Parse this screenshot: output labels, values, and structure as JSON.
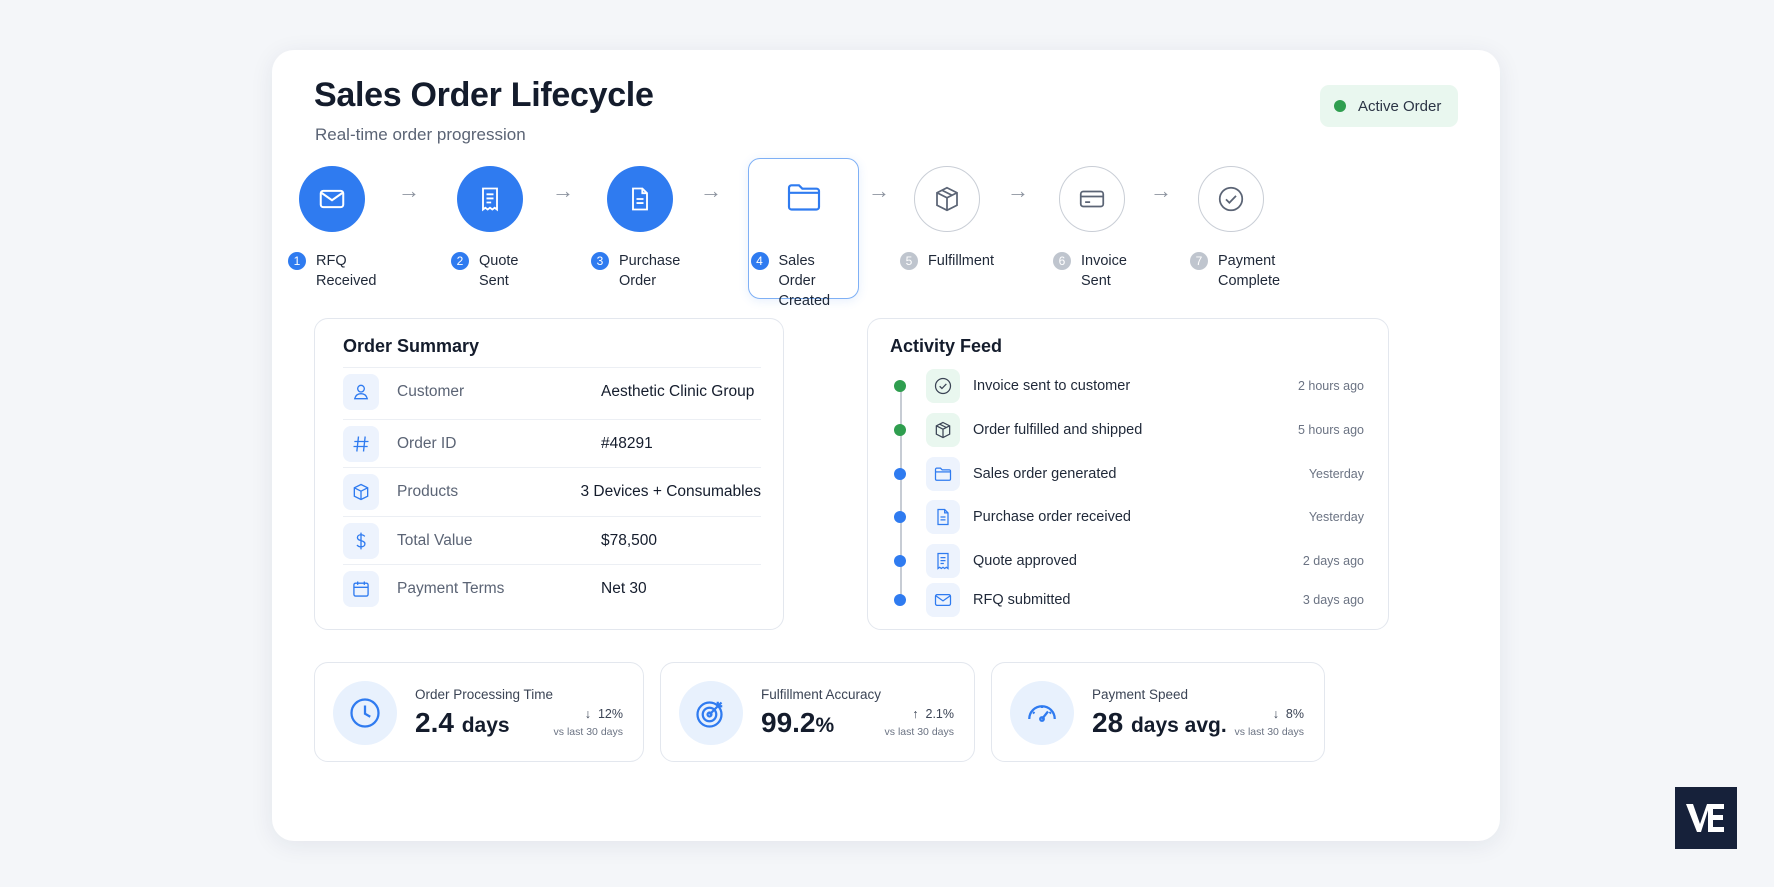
{
  "header": {
    "title": "Sales Order Lifecycle",
    "subtitle": "Real-time order progression",
    "status_label": "Active Order",
    "status_color": "#2f9e4f"
  },
  "steps": [
    {
      "num": "1",
      "label": "RFQ Received",
      "icon": "envelope-icon",
      "state": "done"
    },
    {
      "num": "2",
      "label": "Quote Sent",
      "icon": "receipt-icon",
      "state": "done"
    },
    {
      "num": "3",
      "label": "Purchase Order",
      "icon": "document-icon",
      "state": "done"
    },
    {
      "num": "4",
      "label": "Sales Order Created",
      "icon": "folder-icon",
      "state": "current"
    },
    {
      "num": "5",
      "label": "Fulfillment",
      "icon": "box-icon",
      "state": "pending"
    },
    {
      "num": "6",
      "label": "Invoice Sent",
      "icon": "credit-card-icon",
      "state": "pending"
    },
    {
      "num": "7",
      "label": "Payment Complete",
      "icon": "check-circle-icon",
      "state": "pending"
    }
  ],
  "summary": {
    "title": "Order Summary",
    "rows": [
      {
        "key": "Customer",
        "value": "Aesthetic Clinic Group",
        "icon": "user-icon"
      },
      {
        "key": "Order ID",
        "value": "#48291",
        "icon": "hash-icon"
      },
      {
        "key": "Products",
        "value": "3 Devices + Consumables",
        "icon": "box-icon"
      },
      {
        "key": "Total Value",
        "value": "$78,500",
        "icon": "dollar-icon"
      },
      {
        "key": "Payment Terms",
        "value": "Net 30",
        "icon": "calendar-icon"
      }
    ]
  },
  "feed": {
    "title": "Activity Feed",
    "items": [
      {
        "text": "Invoice sent to customer",
        "time": "2 hours ago",
        "icon": "check-circle-icon",
        "dot_color": "#2f9e4f"
      },
      {
        "text": "Order fulfilled and shipped",
        "time": "5 hours ago",
        "icon": "box-icon",
        "dot_color": "#2f9e4f"
      },
      {
        "text": "Sales order generated",
        "time": "Yesterday",
        "icon": "folder-icon",
        "dot_color": "#2f7bf0"
      },
      {
        "text": "Purchase order received",
        "time": "Yesterday",
        "icon": "document-icon",
        "dot_color": "#2f7bf0"
      },
      {
        "text": "Quote approved",
        "time": "2 days ago",
        "icon": "receipt-icon",
        "dot_color": "#2f7bf0"
      },
      {
        "text": "RFQ submitted",
        "time": "3 days ago",
        "icon": "envelope-icon",
        "dot_color": "#2f7bf0"
      }
    ]
  },
  "metrics": [
    {
      "label": "Order Processing Time",
      "value": "2.4",
      "unit": "days",
      "delta": "12%",
      "direction": "down",
      "compare": "vs last 30 days",
      "icon": "clock-icon"
    },
    {
      "label": "Fulfillment Accuracy",
      "value": "99.2",
      "unit": "%",
      "delta": "2.1%",
      "direction": "up",
      "compare": "vs last 30 days",
      "icon": "target-icon"
    },
    {
      "label": "Payment Speed",
      "value": "28",
      "unit": "days avg.",
      "delta": "8%",
      "direction": "down",
      "compare": "vs last 30 days",
      "icon": "speedometer-icon"
    }
  ],
  "colors": {
    "accent": "#2f7bf0",
    "success": "#2f9e4f",
    "logo_bg": "#16213a"
  }
}
